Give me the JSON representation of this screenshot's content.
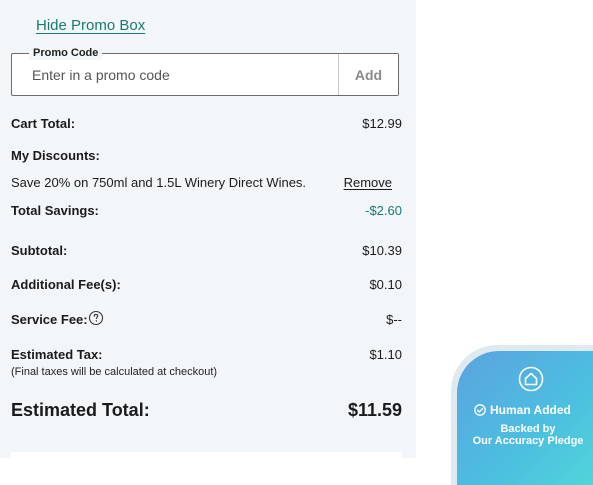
{
  "promo": {
    "toggle_label": "Hide Promo Box",
    "legend": "Promo Code",
    "placeholder": "Enter in a promo code",
    "value": "",
    "add_label": "Add"
  },
  "summary": {
    "cart_total": {
      "label": "Cart Total:",
      "value": "$12.99"
    },
    "discounts": {
      "label": "My Discounts:",
      "items": [
        {
          "text": "Save 20% on 750ml and 1.5L Winery Direct Wines.",
          "action": "Remove"
        }
      ]
    },
    "total_savings": {
      "label": "Total Savings:",
      "value": "-$2.60"
    },
    "subtotal": {
      "label": "Subtotal:",
      "value": "$10.39"
    },
    "additional_fees": {
      "label": "Additional Fee(s):",
      "value": "$0.10"
    },
    "service_fee": {
      "label": "Service Fee:",
      "value": "$--"
    },
    "estimated_tax": {
      "label": "Estimated Tax:",
      "value": "$1.10",
      "note": "(Final taxes will be calculated at checkout)"
    },
    "estimated_total": {
      "label": "Estimated Total:",
      "value": "$11.59"
    }
  },
  "badge": {
    "title": "Human Added",
    "line1": "Backed by",
    "line2": "Our Accuracy Pledge"
  },
  "colors": {
    "accent": "#1a7a6f",
    "panel_bg": "#f2f6f9",
    "badge_gradient_start": "#5ba3df",
    "badge_gradient_end": "#52dad7"
  }
}
